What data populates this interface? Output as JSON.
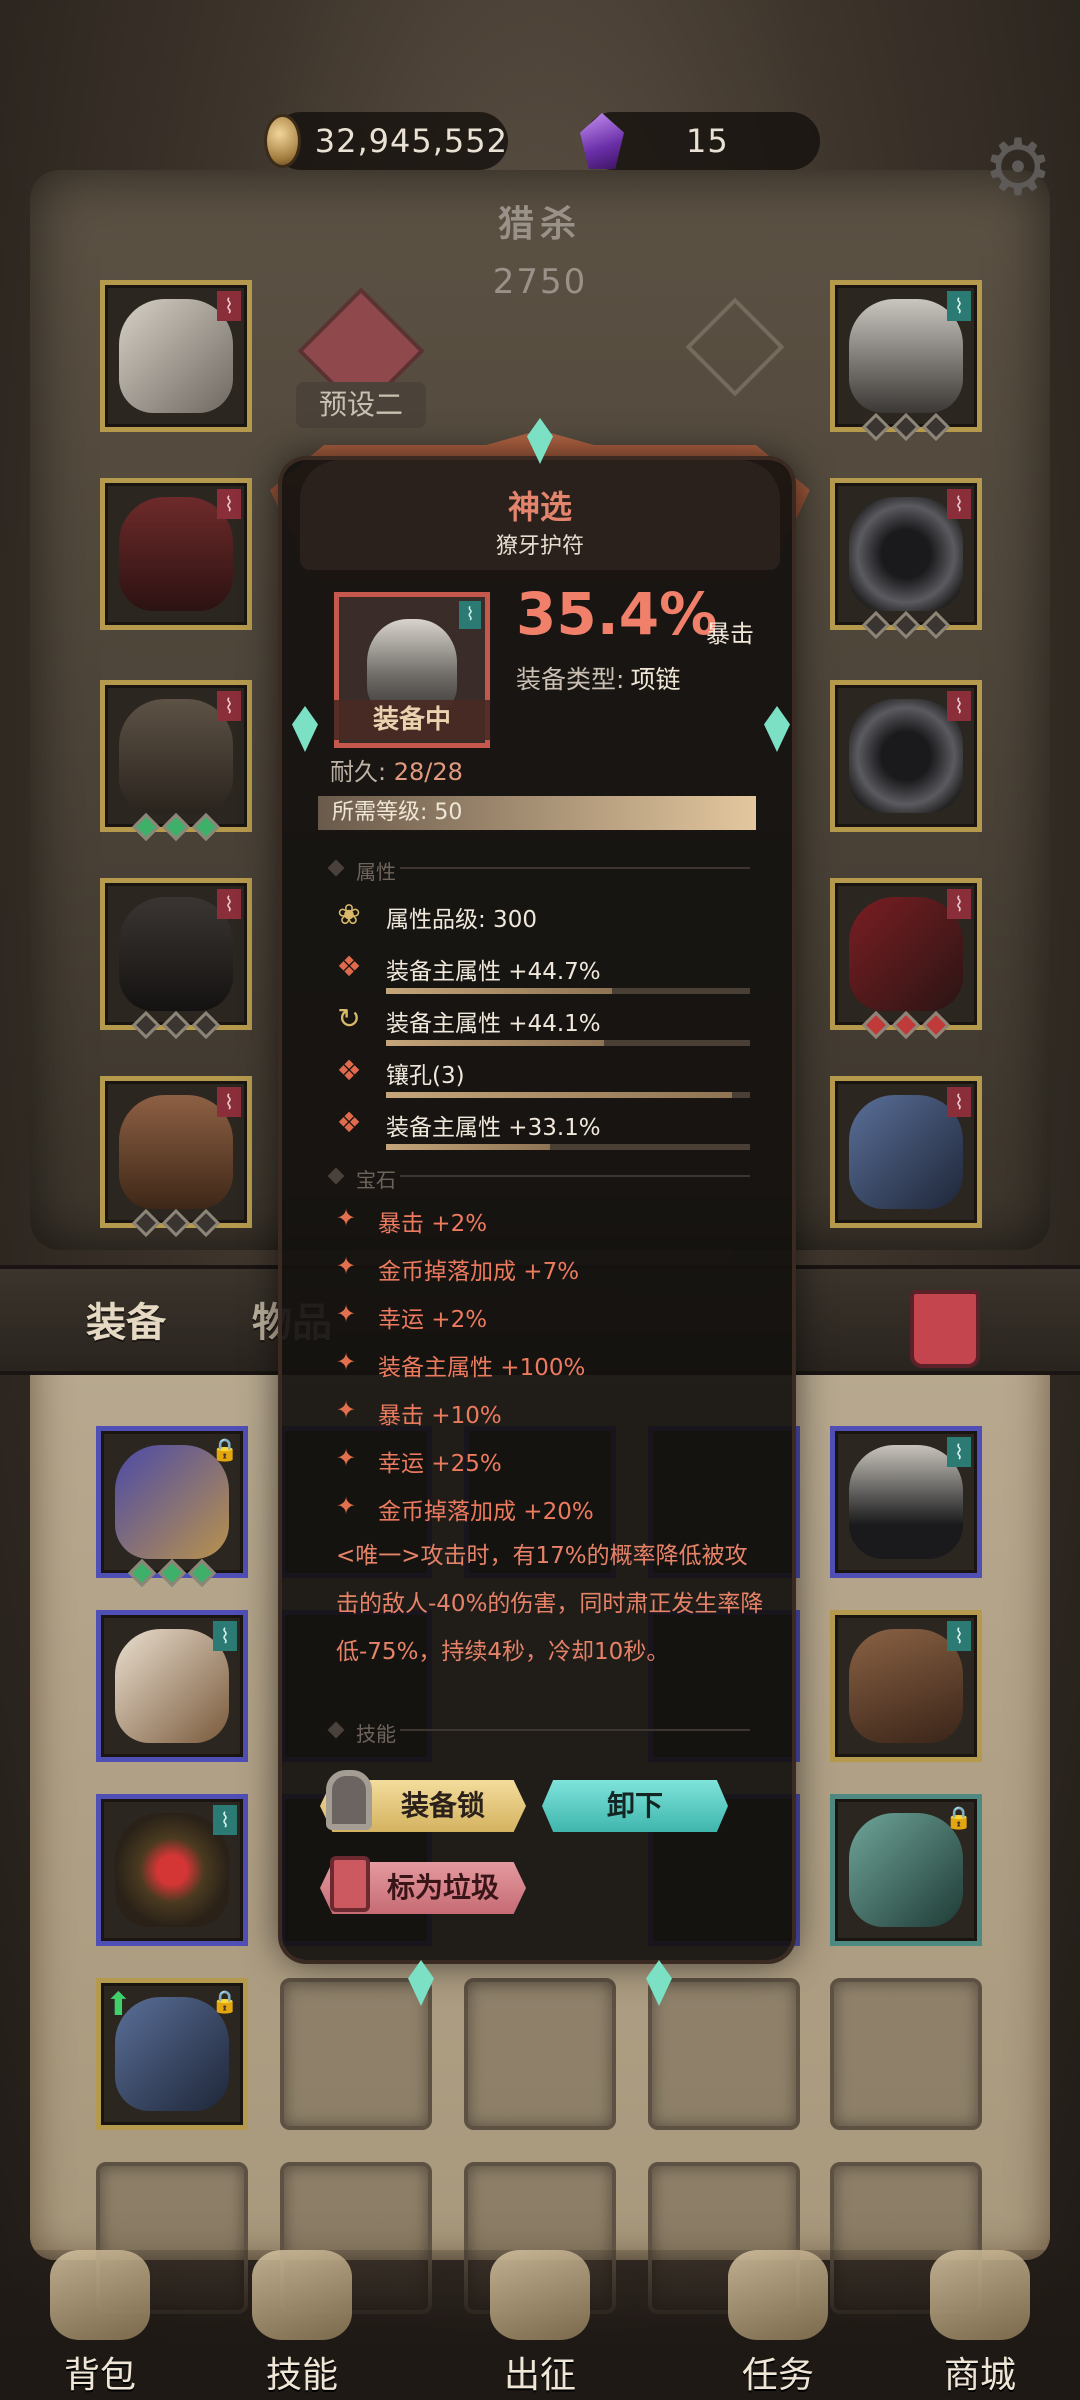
{
  "currency": {
    "gold": "32,945,552",
    "gems": "15"
  },
  "hunt": {
    "title": "猎杀",
    "value": "2750"
  },
  "preset": {
    "label": "预设二"
  },
  "tabs": {
    "equipment": "装备",
    "items": "物品"
  },
  "item": {
    "rarity": "神选",
    "name": "獠牙护符",
    "equipped_tag": "装备中",
    "main_percent": "35.4%",
    "main_stat": "暴击",
    "type_label": "装备类型:",
    "type_value": "项链",
    "durability_label": "耐久:",
    "durability_value": "28/28",
    "required_level": "所需等级: 50",
    "attr_section": "属性",
    "attr_grade": "属性品级: 300",
    "attributes": [
      {
        "text": "装备主属性 +44.7%",
        "fill": 0.62
      },
      {
        "text": "装备主属性 +44.1%",
        "fill": 0.6
      },
      {
        "text": "镶孔(3)",
        "fill": 0.95
      },
      {
        "text": "装备主属性 +33.1%",
        "fill": 0.45
      }
    ],
    "gem_section": "宝石",
    "gems": [
      "暴击 +2%",
      "金币掉落加成 +7%",
      "幸运 +2%",
      "装备主属性 +100%",
      "暴击 +10%",
      "幸运 +25%",
      "金币掉落加成 +20%"
    ],
    "unique_text": "<唯一>攻击时，有17%的概率降低被攻击的敌人-40%的伤害，同时肃正发生率降低-75%，持续4秒，冷却10秒。",
    "skill_section": "技能",
    "btn_lock": "装备锁",
    "btn_unequip": "卸下",
    "btn_junk": "标为垃圾"
  },
  "bottom_nav": [
    {
      "label": "背包"
    },
    {
      "label": "技能"
    },
    {
      "label": "出征"
    },
    {
      "label": "任务"
    },
    {
      "label": "商城"
    }
  ],
  "colors": {
    "accent_red": "#f0806a",
    "gold_frame": "#b59a4e",
    "blue_frame": "#4f4fb6",
    "teal_button": "#3fb6ad",
    "lock_button": "#d4b360"
  }
}
